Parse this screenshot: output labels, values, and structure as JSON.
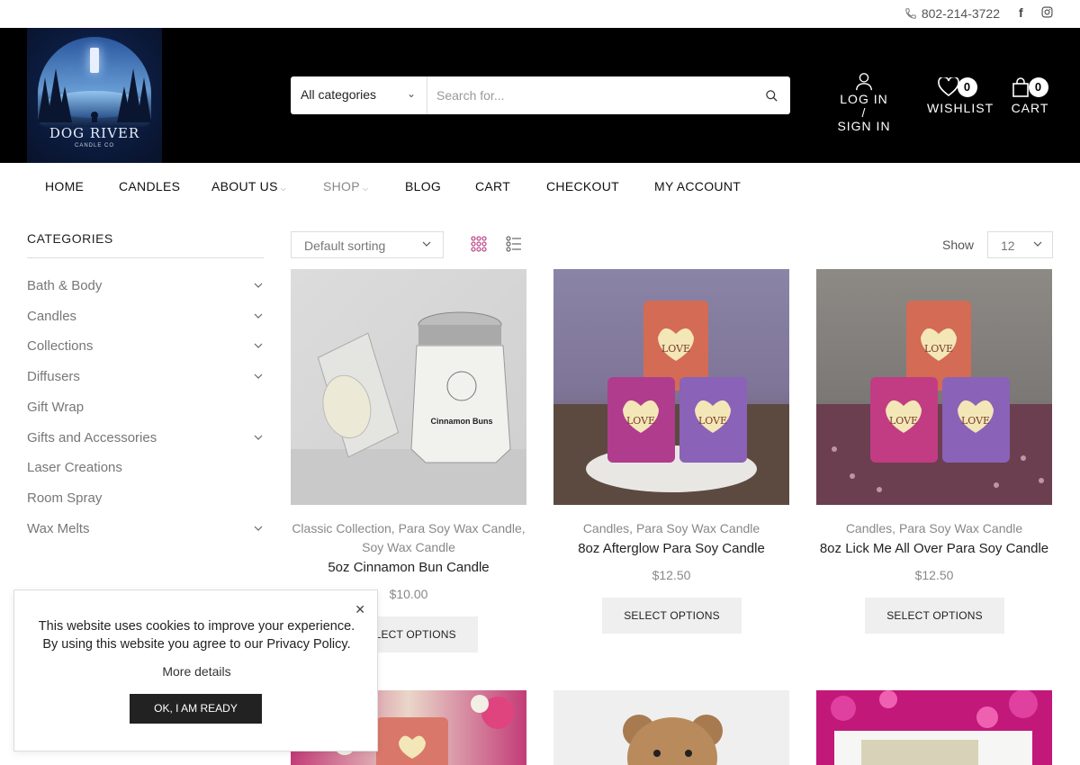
{
  "topbar": {
    "phone": "802-214-3722",
    "icons": [
      "phone-icon",
      "facebook-icon",
      "instagram-icon"
    ]
  },
  "header": {
    "logo": {
      "title": "DOG RIVER",
      "subtitle": "CANDLE CO"
    },
    "search": {
      "category": "All categories",
      "placeholder": "Search for..."
    },
    "login_line1": "LOG IN /",
    "login_line2": "SIGN IN",
    "wishlist_label": "WISHLIST",
    "wishlist_count": "0",
    "cart_label": "CART",
    "cart_count": "0"
  },
  "nav": {
    "items": [
      "HOME",
      "CANDLES",
      "ABOUT US",
      "SHOP",
      "BLOG",
      "CART",
      "CHECKOUT",
      "MY ACCOUNT"
    ]
  },
  "sidebar": {
    "title": "CATEGORIES",
    "items": [
      "Bath & Body",
      "Candles",
      "Collections",
      "Diffusers",
      "Gift Wrap",
      "Gifts and Accessories",
      "Laser Creations",
      "Room Spray",
      "Wax Melts"
    ]
  },
  "toolbar": {
    "sort": "Default sorting",
    "show_label": "Show",
    "show_value": "12"
  },
  "products": [
    {
      "cat_line1": "Classic Collection, Para Soy Wax Candle,",
      "cat_line2": "Soy Wax Candle",
      "name": "5oz Cinnamon Bun Candle",
      "price": "$10.00",
      "button": "SELECT OPTIONS",
      "jar_label": "Cinnamon Buns"
    },
    {
      "cat_line1": "Candles, Para Soy Wax Candle",
      "name": "8oz Afterglow Para Soy Candle",
      "price": "$12.50",
      "button": "SELECT OPTIONS",
      "tag": "LOVE"
    },
    {
      "cat_line1": "Candles, Para Soy Wax Candle",
      "name": "8oz Lick Me All Over Para Soy Candle",
      "price": "$12.50",
      "button": "SELECT OPTIONS",
      "tag": "LOVE"
    }
  ],
  "cookie": {
    "line1": "This website uses cookies to improve your experience.",
    "line2": "By using this website you agree to our Privacy Policy.",
    "more": "More details",
    "ok": "OK, I AM READY"
  },
  "colors": {
    "header_bg": "#000000",
    "accent": "#c0508c",
    "button_bg": "#efefef"
  }
}
